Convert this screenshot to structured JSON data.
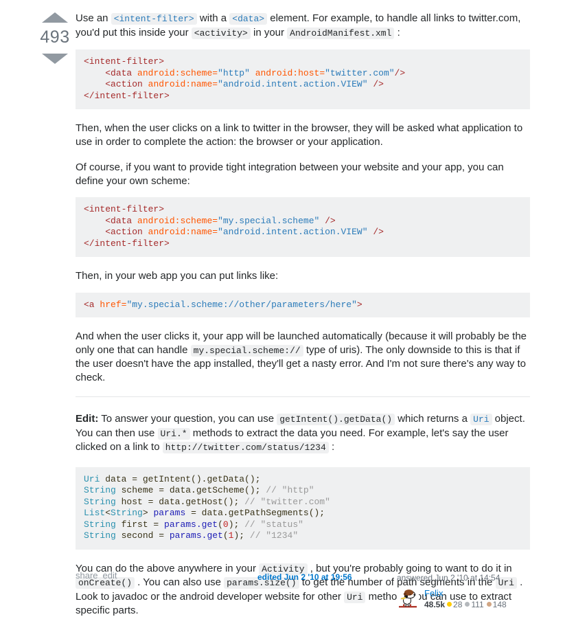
{
  "vote": {
    "up_icon": "arrow-up-icon",
    "down_icon": "arrow-down-icon",
    "count": "493"
  },
  "post": {
    "paragraph_1": {
      "part_1": "Use an ",
      "code_1": "<intent-filter>",
      "part_2": " with a ",
      "code_2": "<data>",
      "part_3": " element. For example, to handle all links to twitter.com, you'd put this inside your ",
      "code_3": "<activity>",
      "part_4": " in your ",
      "code_4": "AndroidManifest.xml",
      "part_5": " :"
    },
    "code_block_1": {
      "lines": [
        "<intent-filter>",
        "    <data android:scheme=\"http\" android:host=\"twitter.com\"/>",
        "    <action android:name=\"android.intent.action.VIEW\" />",
        "</intent-filter>"
      ]
    },
    "paragraph_2": "Then, when the user clicks on a link to twitter in the browser, they will be asked what application to use in order to complete the action: the browser or your application.",
    "paragraph_3": "Of course, if you want to provide tight integration between your website and your app, you can define your own scheme:",
    "code_block_2": {
      "lines": [
        "<intent-filter>",
        "    <data android:scheme=\"my.special.scheme\" />",
        "    <action android:name=\"android.intent.action.VIEW\" />",
        "</intent-filter>"
      ]
    },
    "paragraph_4": "Then, in your web app you can put links like:",
    "code_block_3": {
      "lines": [
        "<a href=\"my.special.scheme://other/parameters/here\">"
      ]
    },
    "paragraph_5": {
      "part_1": "And when the user clicks it, your app will be launched automatically (because it will probably be the only one that can handle ",
      "code_1": "my.special.scheme://",
      "part_2": " type of uris). The only downside to this is that if the user doesn't have the app installed, they'll get a nasty error. And I'm not sure there's any way to check."
    },
    "paragraph_6": {
      "label": "Edit:",
      "part_1": " To answer your question, you can use ",
      "code_1": "getIntent().getData()",
      "part_2": " which returns a ",
      "code_2": "Uri",
      "part_3": " object. You can then use ",
      "code_3": "Uri.*",
      "part_4": " methods to extract the data you need. For example, let's say the user clicked on a link to ",
      "code_4": "http://twitter.com/status/1234",
      "part_5": " :"
    },
    "code_block_4": {
      "lines": [
        "Uri data = getIntent().getData();",
        "String scheme = data.getScheme(); // \"http\"",
        "String host = data.getHost(); // \"twitter.com\"",
        "List<String> params = data.getPathSegments();",
        "String first = params.get(0); // \"status\"",
        "String second = params.get(1); // \"1234\""
      ]
    },
    "paragraph_7": {
      "part_1": "You can do the above anywhere in your ",
      "code_1": "Activity",
      "part_2": " , but you're probably going to want to do it in ",
      "code_2": "onCreate()",
      "part_3": " . You can also use ",
      "code_3": "params.size()",
      "part_4": " to get the number of path segments in the ",
      "code_4": "Uri",
      "part_5": " . Look to javadoc or the android developer website for other ",
      "code_5": "Uri",
      "part_6": " methods you can use to extract specific parts."
    }
  },
  "footer": {
    "share_label": "share",
    "edit_label": "edit",
    "edited_text": "edited Jun 2 '10 at 19:56",
    "answered_text": "answered Jun 2 '10 at 14:54",
    "user_name": "Felix",
    "reputation": "48.5k",
    "gold_badges": "28",
    "silver_badges": "111",
    "bronze_badges": "148",
    "avatar_icon": "snoopy-avatar"
  },
  "colors": {
    "link": "#0077cc",
    "muted": "#9199a1",
    "code_bg": "#eff0f1",
    "gold": "#ffcc01",
    "silver": "#b4b8bc",
    "bronze": "#d1a684"
  }
}
